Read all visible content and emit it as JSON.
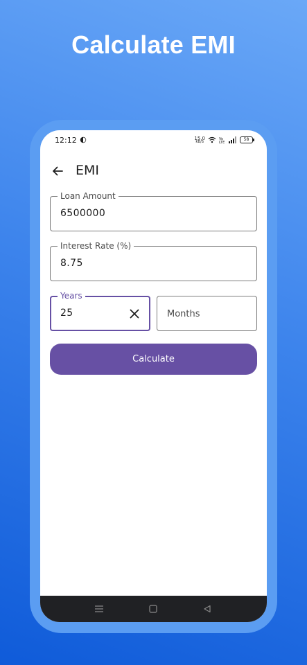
{
  "banner": {
    "title": "Calculate EMI"
  },
  "status_bar": {
    "time": "12:12",
    "net_speed": "15.0",
    "net_unit": "KB/S",
    "battery": "58"
  },
  "app_bar": {
    "title": "EMI",
    "back_icon": "arrow-left-icon"
  },
  "form": {
    "loan_amount": {
      "label": "Loan Amount",
      "value": "6500000"
    },
    "interest_rate": {
      "label": "Interest Rate (%)",
      "value": "8.75"
    },
    "years": {
      "label": "Years",
      "value": "25",
      "clear_icon": "close-icon"
    },
    "months": {
      "placeholder": "Months",
      "value": ""
    },
    "calculate_label": "Calculate"
  },
  "nav_bar": {
    "keys": [
      "menu-icon",
      "home-square-icon",
      "back-triangle-icon"
    ]
  },
  "colors": {
    "accent": "#6750a4",
    "nav_bar": "#202124",
    "frame": "#5b9df2"
  }
}
